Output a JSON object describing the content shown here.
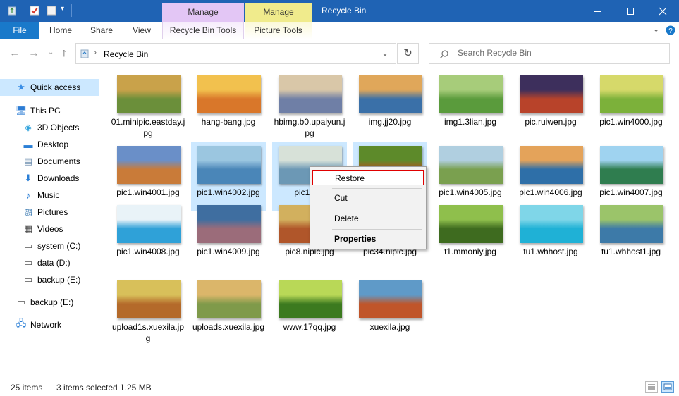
{
  "window": {
    "title": "Recycle Bin",
    "context_tabs": [
      "Manage",
      "Manage"
    ],
    "controls": [
      "minimize",
      "maximize",
      "close"
    ]
  },
  "ribbon": {
    "file": "File",
    "tabs": [
      "Home",
      "Share",
      "View",
      "Recycle Bin Tools",
      "Picture Tools"
    ]
  },
  "address": {
    "path": "Recycle Bin",
    "search_placeholder": "Search Recycle Bin"
  },
  "sidebar": {
    "items": [
      {
        "label": "Quick access",
        "icon": "star-icon"
      },
      {
        "label": "This PC",
        "icon": "computer-icon"
      },
      {
        "label": "3D Objects",
        "icon": "cube-icon"
      },
      {
        "label": "Desktop",
        "icon": "desktop-icon"
      },
      {
        "label": "Documents",
        "icon": "documents-icon"
      },
      {
        "label": "Downloads",
        "icon": "download-arrow-icon"
      },
      {
        "label": "Music",
        "icon": "music-note-icon"
      },
      {
        "label": "Pictures",
        "icon": "pictures-icon"
      },
      {
        "label": "Videos",
        "icon": "film-icon"
      },
      {
        "label": "system (C:)",
        "icon": "drive-icon"
      },
      {
        "label": "data (D:)",
        "icon": "drive-icon"
      },
      {
        "label": "backup (E:)",
        "icon": "drive-icon"
      },
      {
        "label": "backup (E:)",
        "icon": "drive-icon"
      },
      {
        "label": "Network",
        "icon": "network-icon"
      }
    ]
  },
  "files": [
    {
      "name": "01.minipic.eastday.jpg",
      "selected": false
    },
    {
      "name": "hang-bang.jpg",
      "selected": false
    },
    {
      "name": "hbimg.b0.upaiyun.jpg",
      "selected": false
    },
    {
      "name": "img.jj20.jpg",
      "selected": false
    },
    {
      "name": "img1.3lian.jpg",
      "selected": false
    },
    {
      "name": "pic.ruiwen.jpg",
      "selected": false
    },
    {
      "name": "pic1.win4000.jpg",
      "selected": false
    },
    {
      "name": "pic1.win4001.jpg",
      "selected": false
    },
    {
      "name": "pic1.win4002.jpg",
      "selected": true
    },
    {
      "name": "pic1.win",
      "selected": true
    },
    {
      "name": "",
      "selected": true
    },
    {
      "name": "pic1.win4005.jpg",
      "selected": false
    },
    {
      "name": "pic1.win4006.jpg",
      "selected": false
    },
    {
      "name": "pic1.win4007.jpg",
      "selected": false
    },
    {
      "name": "pic1.win4008.jpg",
      "selected": false
    },
    {
      "name": "pic1.win4009.jpg",
      "selected": false
    },
    {
      "name": "pic8.nipic.jpg",
      "selected": false
    },
    {
      "name": "pic34.nipic.jpg",
      "selected": false
    },
    {
      "name": "t1.mmonly.jpg",
      "selected": false
    },
    {
      "name": "tu1.whhost.jpg",
      "selected": false
    },
    {
      "name": "tu1.whhost1.jpg",
      "selected": false
    },
    {
      "name": "upload1s.xuexila.jpg",
      "selected": false
    },
    {
      "name": "uploads.xuexila.jpg",
      "selected": false
    },
    {
      "name": "www.17qq.jpg",
      "selected": false
    },
    {
      "name": "xuexila.jpg",
      "selected": false
    }
  ],
  "context_menu": {
    "items": [
      "Restore",
      "Cut",
      "Delete",
      "Properties"
    ]
  },
  "status": {
    "count": "25 items",
    "selection": "3 items selected",
    "size": "1.25 MB"
  },
  "colors": {
    "titlebar": "#1f63b4",
    "file_tab": "#1979ca",
    "manage_picture": "#e3c6f5",
    "manage_recycle": "#f0eb8c",
    "selection": "#cce8ff",
    "restore_highlight_border": "#e00000"
  }
}
